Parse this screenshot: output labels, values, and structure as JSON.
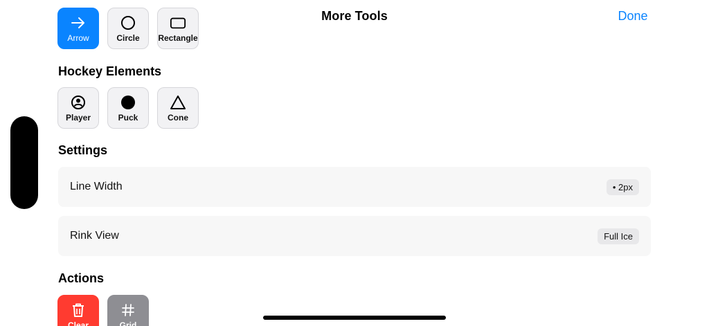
{
  "header": {
    "title": "More Tools",
    "done_label": "Done"
  },
  "drawing_tools": [
    {
      "label": "Arrow",
      "icon": "arrow-right-icon",
      "selected": true
    },
    {
      "label": "Circle",
      "icon": "circle-icon",
      "selected": false
    },
    {
      "label": "Rectangle",
      "icon": "rectangle-icon",
      "selected": false
    }
  ],
  "hockey_elements": {
    "title": "Hockey Elements",
    "items": [
      {
        "label": "Player",
        "icon": "player-icon"
      },
      {
        "label": "Puck",
        "icon": "puck-icon"
      },
      {
        "label": "Cone",
        "icon": "cone-icon"
      }
    ]
  },
  "settings": {
    "title": "Settings",
    "rows": [
      {
        "label": "Line Width",
        "value": "• 2px"
      },
      {
        "label": "Rink View",
        "value": "Full Ice"
      }
    ]
  },
  "actions": {
    "title": "Actions",
    "items": [
      {
        "label": "Clear",
        "icon": "trash-icon",
        "color": "#ff3b30"
      },
      {
        "label": "Grid",
        "icon": "grid-icon",
        "color": "#8e8e93"
      }
    ]
  },
  "colors": {
    "accent": "#0a84ff",
    "danger": "#ff3b30",
    "neutral": "#8e8e93"
  }
}
